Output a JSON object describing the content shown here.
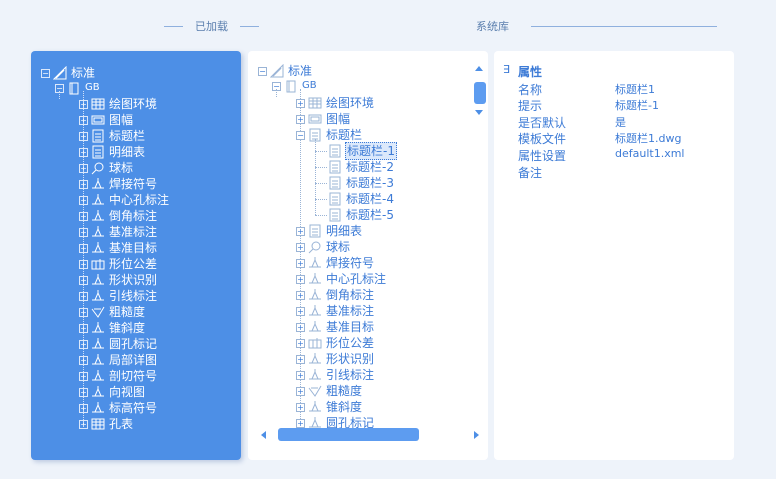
{
  "headers": {
    "loaded": "已加载",
    "library": "系统库"
  },
  "left_tree": {
    "root": "标准",
    "sub": "GB",
    "items": [
      "绘图环境",
      "图幅",
      "标题栏",
      "明细表",
      "球标",
      "焊接符号",
      "中心孔标注",
      "倒角标注",
      "基准标注",
      "基准目标",
      "形位公差",
      "形状识别",
      "引线标注",
      "粗糙度",
      "锥斜度",
      "圆孔标记",
      "局部详图",
      "剖切符号",
      "向视图",
      "标高符号",
      "孔表"
    ]
  },
  "mid_tree": {
    "root": "标准",
    "sub": "GB",
    "items_before": [
      "绘图环境",
      "图幅"
    ],
    "expanded": "标题栏",
    "children": [
      "标题栏-1",
      "标题栏-2",
      "标题栏-3",
      "标题栏-4",
      "标题栏-5"
    ],
    "selected_index": 0,
    "items_after": [
      "明细表",
      "球标",
      "焊接符号",
      "中心孔标注",
      "倒角标注",
      "基准标注",
      "基准目标",
      "形位公差",
      "形状识别",
      "引线标注",
      "粗糙度",
      "锥斜度",
      "圆孔标记"
    ]
  },
  "properties": {
    "group_toggle": "∃",
    "title": "属性",
    "rows": [
      {
        "key": "名称",
        "value": "标题栏1"
      },
      {
        "key": "提示",
        "value": "标题栏-1"
      },
      {
        "key": "是否默认",
        "value": "是"
      },
      {
        "key": "模板文件",
        "value": "标题栏1.dwg"
      },
      {
        "key": "属性设置",
        "value": "default1.xml"
      },
      {
        "key": "备注",
        "value": ""
      }
    ]
  },
  "colors": {
    "accent": "#4d8fe6",
    "text": "#3d7bd6",
    "bg": "#eef3fa"
  }
}
